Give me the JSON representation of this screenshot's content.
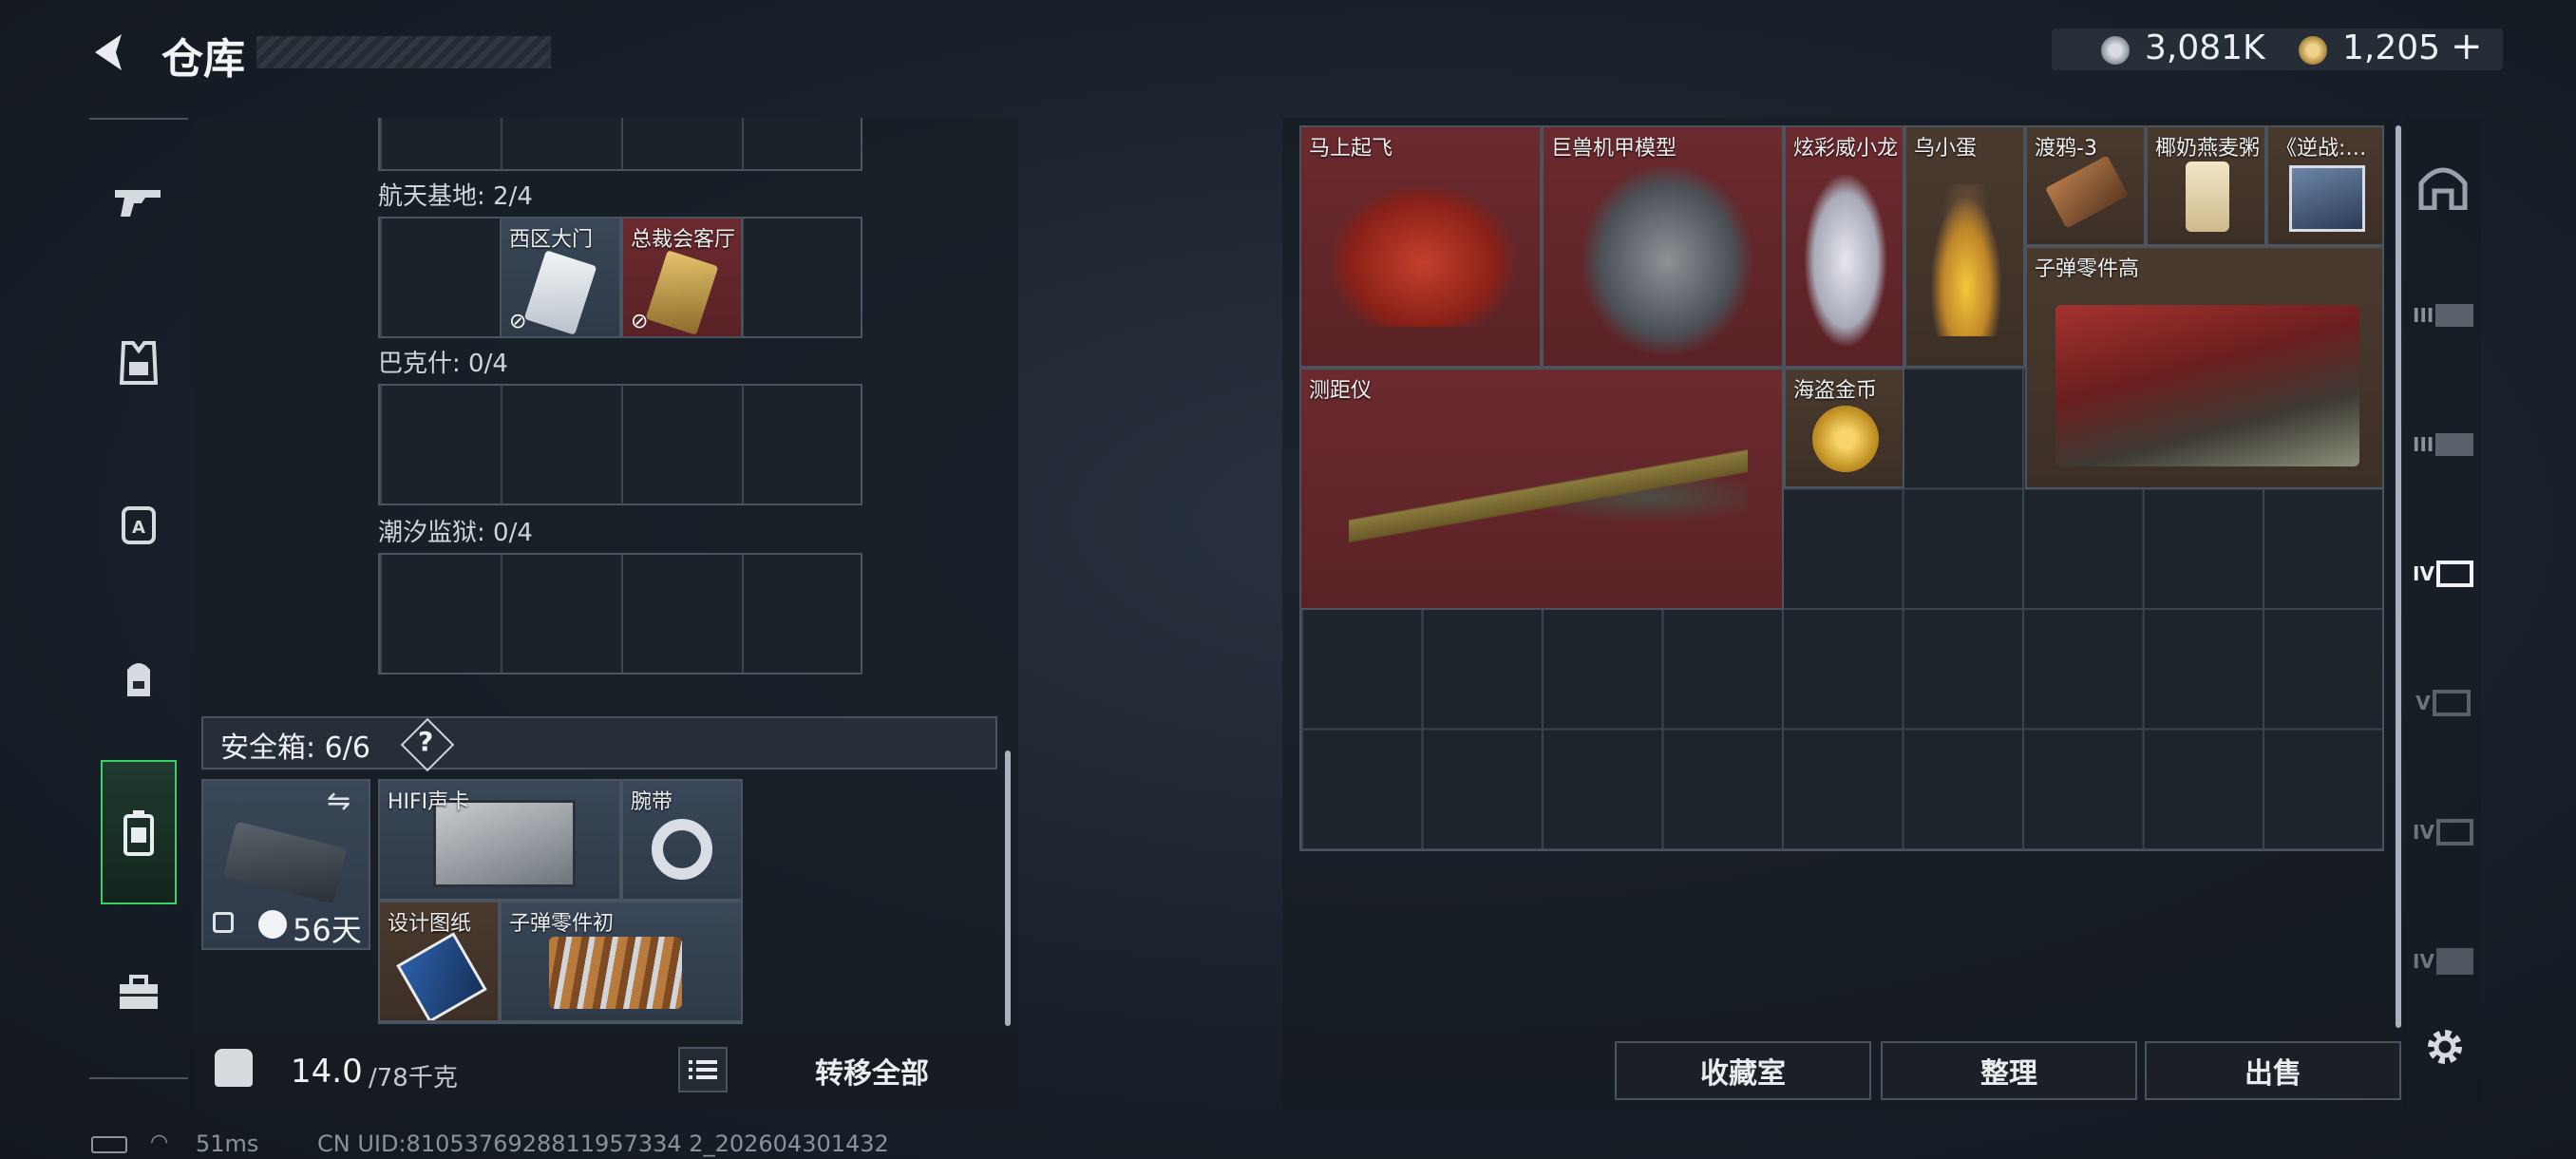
{
  "header": {
    "title": "仓库"
  },
  "currency": {
    "coins": "3,081K",
    "gold": "1,205",
    "gold_plus": "+"
  },
  "locations": [
    {
      "label": "航天基地: 2/4",
      "items": [
        "西区大门",
        "总裁会客厅"
      ]
    },
    {
      "label": "巴克什: 0/4",
      "items": []
    },
    {
      "label": "潮汐监狱: 0/4",
      "items": []
    }
  ],
  "safe_box": {
    "label": "安全箱: 6/6",
    "help": "?",
    "days": "56天",
    "items": [
      "HIFI声卡",
      "腕带",
      "设计图纸",
      "子弹零件初"
    ]
  },
  "footer_left": {
    "weight": "14.0",
    "weight_cap": "/78千克",
    "transfer_all": "转移全部"
  },
  "stash_items": [
    "马上起飞",
    "巨兽机甲模型",
    "炫彩威小龙",
    "乌小蛋",
    "渡鸦-3",
    "椰奶燕麦粥",
    "《逆战:…",
    "子弹零件高",
    "测距仪",
    "海盗金币"
  ],
  "right_buttons": {
    "collection": "收藏室",
    "sort": "整理",
    "sell": "出售"
  },
  "status_bar": {
    "ping": "51ms",
    "uid": "CN UID:8105376928811957334 2_202604301432"
  },
  "right_tabs": [
    "",
    "III",
    "III",
    "IV",
    "V",
    "IV",
    "IV"
  ],
  "colors": {
    "accent_green": "#3ad06a",
    "item_red": "#6b2a2e",
    "item_brown": "#4a3a2e"
  }
}
